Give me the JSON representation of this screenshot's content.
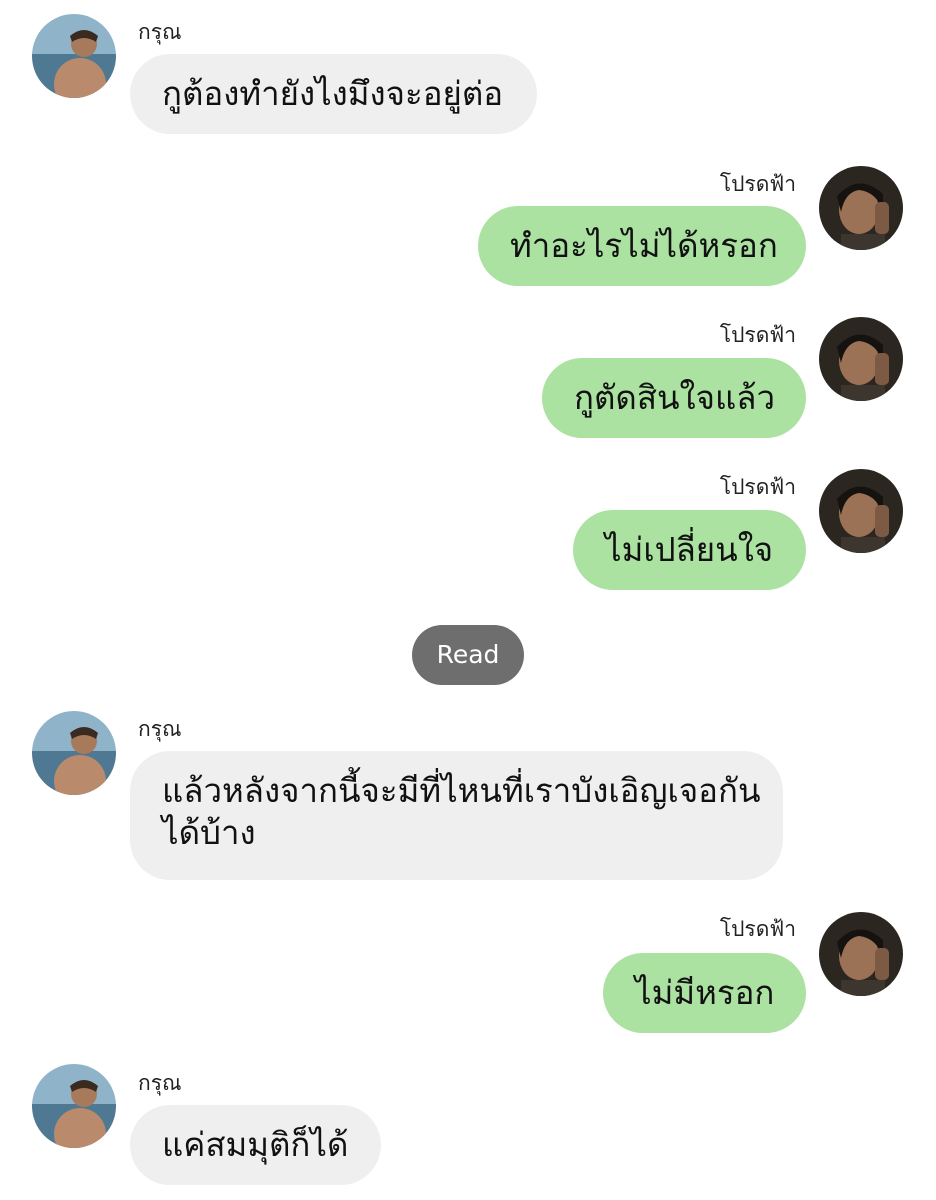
{
  "participants": {
    "left_name": "กรุณ",
    "right_name": "โปรดฟ้า"
  },
  "messages": [
    {
      "side": "left",
      "sender": "กรุณ",
      "lines": [
        "กูต้องทำยังไงมึงจะอยู่ต่อ"
      ]
    },
    {
      "side": "right",
      "sender": "โปรดฟ้า",
      "lines": [
        "ทำอะไรไม่ได้หรอก"
      ]
    },
    {
      "side": "right",
      "sender": "โปรดฟ้า",
      "lines": [
        "กูตัดสินใจแล้ว"
      ]
    },
    {
      "side": "right",
      "sender": "โปรดฟ้า",
      "lines": [
        "ไม่เปลี่ยนใจ"
      ]
    },
    {
      "side": "left",
      "sender": "กรุณ",
      "lines": [
        "แล้วหลังจากนี้จะมีที่ไหนที่เราบังเอิญเจอกัน",
        "ได้บ้าง"
      ]
    },
    {
      "side": "right",
      "sender": "โปรดฟ้า",
      "lines": [
        "ไม่มีหรอก"
      ]
    },
    {
      "side": "left",
      "sender": "กรุณ",
      "lines": [
        "แค่สมมุติก็ได้"
      ]
    }
  ],
  "read_receipt": "Read",
  "colors": {
    "left_bubble": "#efefef",
    "right_bubble": "#abe1a1",
    "read_pill": "#6e6e6e"
  },
  "icons": {
    "left_avatar": "avatar-shirtless-man-sea",
    "right_avatar": "avatar-person-phone"
  }
}
